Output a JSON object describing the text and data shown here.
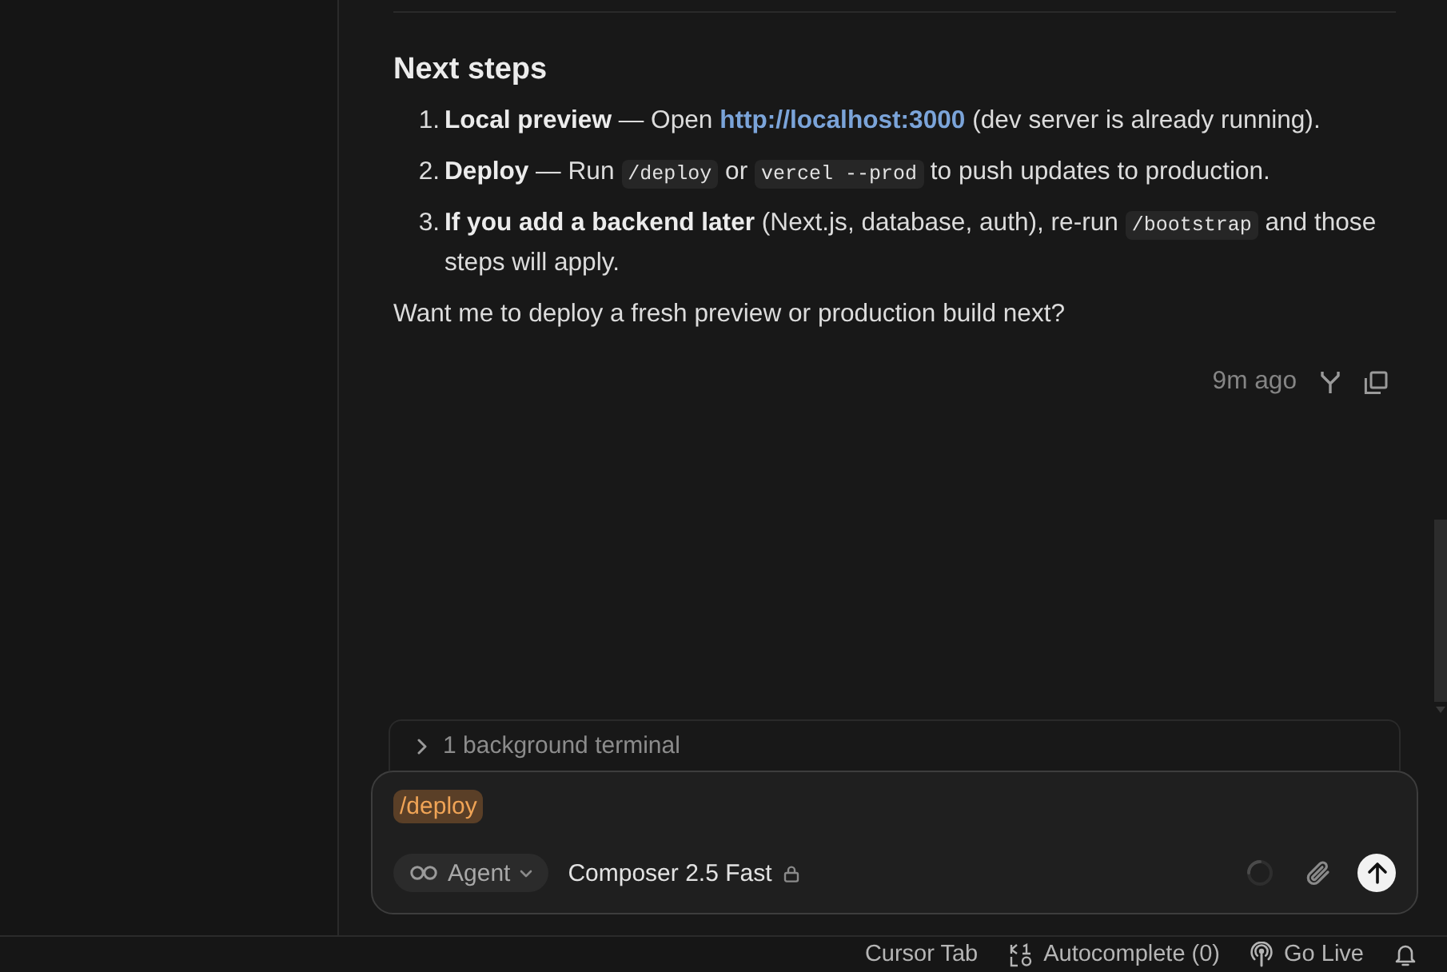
{
  "message": {
    "heading": "Next steps",
    "steps": [
      {
        "number": "1.",
        "segments": [
          {
            "kind": "bold",
            "text": "Local preview"
          },
          {
            "kind": "text",
            "text": " — Open "
          },
          {
            "kind": "link",
            "text": "http://localhost:3000"
          },
          {
            "kind": "text",
            "text": " (dev server is already running)."
          }
        ]
      },
      {
        "number": "2.",
        "segments": [
          {
            "kind": "bold",
            "text": "Deploy"
          },
          {
            "kind": "text",
            "text": " — Run "
          },
          {
            "kind": "code",
            "text": "/deploy"
          },
          {
            "kind": "text",
            "text": " or "
          },
          {
            "kind": "code",
            "text": "vercel --prod"
          },
          {
            "kind": "text",
            "text": " to push updates to production."
          }
        ]
      },
      {
        "number": "3.",
        "segments": [
          {
            "kind": "bold",
            "text": "If you add a backend later"
          },
          {
            "kind": "text",
            "text": " (Next.js, database, auth), re-run "
          },
          {
            "kind": "code",
            "text": "/bootstrap"
          },
          {
            "kind": "text",
            "text": " and those steps will apply."
          }
        ]
      }
    ],
    "closing": "Want me to deploy a fresh preview or production build next?",
    "time": "9m ago"
  },
  "terminal_bar": {
    "label": "1 background terminal",
    "expanded": false
  },
  "composer": {
    "command": "/deploy",
    "mode": "Agent",
    "model": "Composer 2.5 Fast",
    "model_locked": true,
    "busy": true
  },
  "status_bar": {
    "items": [
      {
        "kind": "plain",
        "label": "Cursor Tab"
      },
      {
        "kind": "autocomplete",
        "label": "Autocomplete (0)"
      },
      {
        "kind": "live",
        "label": "Go Live"
      },
      {
        "kind": "notifications"
      }
    ]
  }
}
